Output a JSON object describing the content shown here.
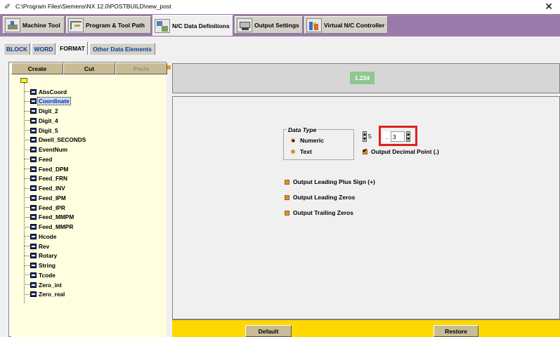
{
  "window": {
    "title": "C:\\Program Files\\Siemens\\NX 12.0\\POSTBUILD\\new_post",
    "close_glyph": "✕"
  },
  "main_tabs": [
    {
      "label": "Machine Tool",
      "icon": "machine-tool-icon"
    },
    {
      "label": "Program & Tool Path",
      "icon": "program-toolpath-icon"
    },
    {
      "label": "N/C Data Definitions",
      "icon": "nc-data-icon",
      "active": true
    },
    {
      "label": "Output Settings",
      "icon": "output-settings-icon"
    },
    {
      "label": "Virtual N/C Controller",
      "icon": "virtual-nc-icon"
    }
  ],
  "sub_tabs": [
    {
      "label": "BLOCK"
    },
    {
      "label": "WORD"
    },
    {
      "label": "FORMAT",
      "active": true
    },
    {
      "label": "Other Data Elements"
    }
  ],
  "tree_buttons": {
    "create": "Create",
    "cut": "Cut",
    "paste": "Paste"
  },
  "tree_items": [
    {
      "label": "AbsCoord"
    },
    {
      "label": "Coordinate",
      "selected": true
    },
    {
      "label": "Digit_2"
    },
    {
      "label": "Digit_4"
    },
    {
      "label": "Digit_5"
    },
    {
      "label": "Dwell_SECONDS"
    },
    {
      "label": "EventNum"
    },
    {
      "label": "Feed"
    },
    {
      "label": "Feed_DPM"
    },
    {
      "label": "Feed_FRN"
    },
    {
      "label": "Feed_INV"
    },
    {
      "label": "Feed_IPM"
    },
    {
      "label": "Feed_IPR"
    },
    {
      "label": "Feed_MMPM"
    },
    {
      "label": "Feed_MMPR"
    },
    {
      "label": "Hcode"
    },
    {
      "label": "Rev"
    },
    {
      "label": "Rotary"
    },
    {
      "label": "String"
    },
    {
      "label": "Tcode"
    },
    {
      "label": "Zero_int"
    },
    {
      "label": "Zero_real"
    }
  ],
  "preview": {
    "value": "1.234",
    "color": "#8fc88f"
  },
  "format": {
    "data_type_legend": "Data Type",
    "numeric_label": "Numeric",
    "text_label": "Text",
    "numeric_selected": true,
    "integer_digits": "5",
    "separator": ".",
    "fraction_digits": "3",
    "output_decimal_point": {
      "label": "Output Decimal Point (.)",
      "checked": true
    },
    "leading_plus": {
      "label": "Output Leading Plus Sign (+)",
      "checked": false
    },
    "leading_zeros": {
      "label": "Output Leading Zeros",
      "checked": false
    },
    "trailing_zeros": {
      "label": "Output Trailing Zeros",
      "checked": false
    }
  },
  "bottom_buttons": {
    "default": "Default",
    "restore": "Restore"
  },
  "colors": {
    "tab_strip": "#9b7bab",
    "bottom_bar": "#ffd800",
    "tree_bg": "#ffffe0",
    "highlight": "#e02020",
    "button": "#c9bc94"
  }
}
